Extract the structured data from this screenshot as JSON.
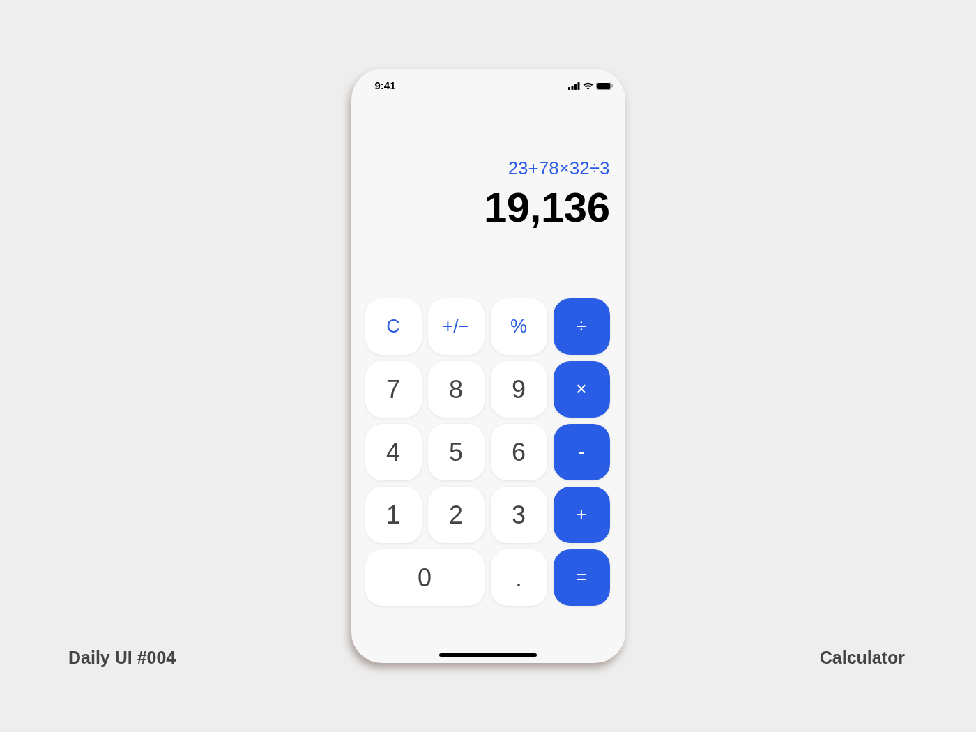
{
  "status_bar": {
    "time": "9:41"
  },
  "display": {
    "expression": "23+78×32÷3",
    "result": "19,136"
  },
  "keypad": [
    {
      "label": "C",
      "kind": "function",
      "wide": false
    },
    {
      "label": "+/−",
      "kind": "function",
      "wide": false
    },
    {
      "label": "%",
      "kind": "function",
      "wide": false
    },
    {
      "label": "÷",
      "kind": "operator",
      "wide": false
    },
    {
      "label": "7",
      "kind": "digit",
      "wide": false
    },
    {
      "label": "8",
      "kind": "digit",
      "wide": false
    },
    {
      "label": "9",
      "kind": "digit",
      "wide": false
    },
    {
      "label": "×",
      "kind": "operator",
      "wide": false
    },
    {
      "label": "4",
      "kind": "digit",
      "wide": false
    },
    {
      "label": "5",
      "kind": "digit",
      "wide": false
    },
    {
      "label": "6",
      "kind": "digit",
      "wide": false
    },
    {
      "label": "-",
      "kind": "operator",
      "wide": false
    },
    {
      "label": "1",
      "kind": "digit",
      "wide": false
    },
    {
      "label": "2",
      "kind": "digit",
      "wide": false
    },
    {
      "label": "3",
      "kind": "digit",
      "wide": false
    },
    {
      "label": "+",
      "kind": "operator",
      "wide": false
    },
    {
      "label": "0",
      "kind": "digit",
      "wide": true
    },
    {
      "label": ".",
      "kind": "digit",
      "wide": false
    },
    {
      "label": "=",
      "kind": "operator",
      "wide": false
    }
  ],
  "captions": {
    "left": "Daily UI #004",
    "right": "Calculator"
  }
}
